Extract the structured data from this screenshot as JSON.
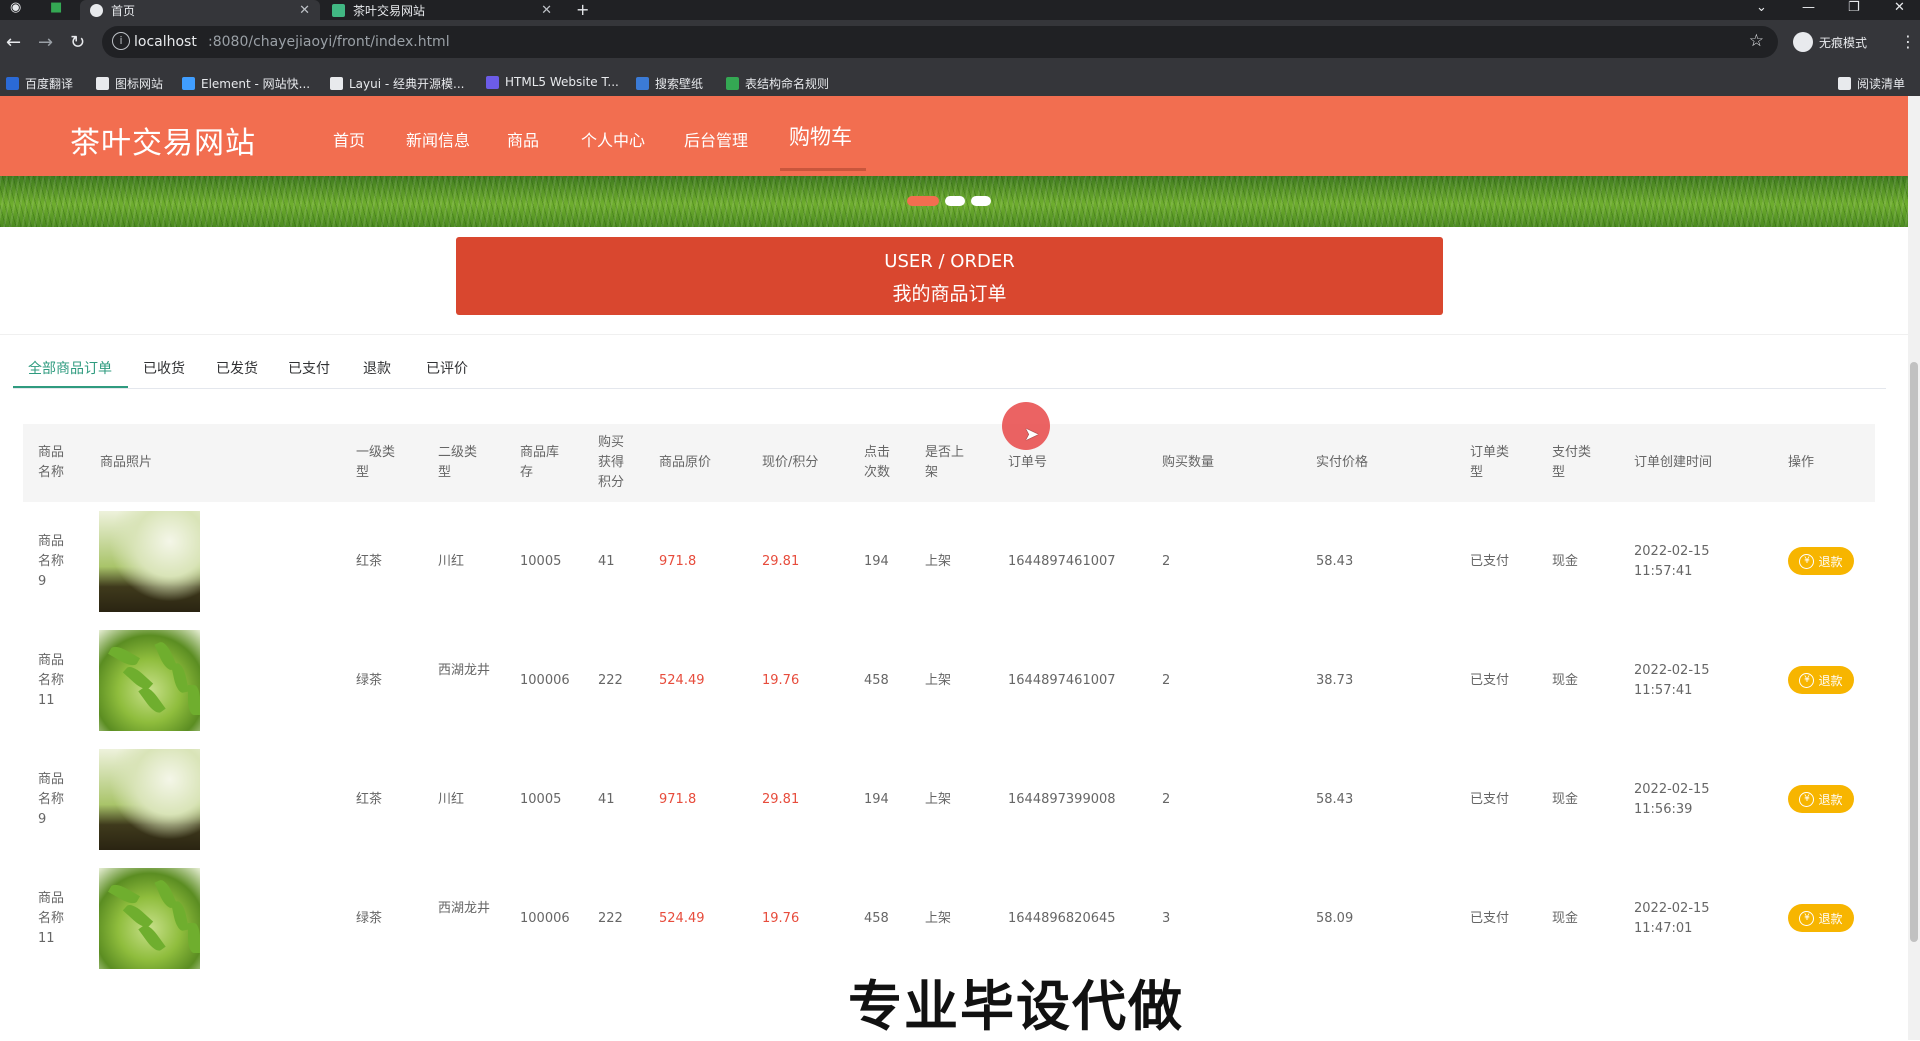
{
  "browser": {
    "tabs": [
      {
        "title": "首页",
        "active": true
      },
      {
        "title": "茶叶交易网站",
        "active": false
      }
    ],
    "new_tab": "+",
    "url_host": "localhost",
    "url_path": ":8080/chayejiaoyi/front/index.html",
    "incognito_label": "无痕模式",
    "bookmarks": [
      "百度翻译",
      "图标网站",
      "Element - 网站快...",
      "Layui - 经典开源模...",
      "HTML5 Website T...",
      "搜索壁纸",
      "表结构命名规则"
    ],
    "reading_list": "阅读清单"
  },
  "site": {
    "title": "茶叶交易网站",
    "nav": [
      "首页",
      "新闻信息",
      "商品",
      "个人中心",
      "后台管理",
      "购物车"
    ],
    "active_nav": "购物车",
    "accent_color": "#f26e50"
  },
  "hero": {
    "line1": "USER / ORDER",
    "line2": "我的商品订单"
  },
  "order_tabs": [
    "全部商品订单",
    "已收货",
    "已发货",
    "已支付",
    "退款",
    "已评价"
  ],
  "table": {
    "headers": [
      "商品名称",
      "商品照片",
      "一级类型",
      "二级类型",
      "商品库存",
      "购买获得积分",
      "商品原价",
      "现价/积分",
      "点击次数",
      "是否上架",
      "订单号",
      "购买数量",
      "实付价格",
      "订单类型",
      "支付类型",
      "订单创建时间",
      "操作"
    ],
    "rows": [
      {
        "name": "商品名称9",
        "photo": "tea-sprout-photo",
        "type1": "红茶",
        "type2": "川红",
        "stock": "10005",
        "points": "41",
        "orig_price": "971.8",
        "cur_price": "29.81",
        "clicks": "194",
        "on_shelf": "上架",
        "order_no": "1644897461007",
        "qty": "2",
        "paid": "58.43",
        "order_type": "已支付",
        "pay_type": "现金",
        "created_date": "2022-02-15",
        "created_time": "11:57:41",
        "action": "退款"
      },
      {
        "name": "商品名称11",
        "photo": "green-tea-leaves-photo",
        "type1": "绿茶",
        "type2": "西湖龙井",
        "stock": "100006",
        "points": "222",
        "orig_price": "524.49",
        "cur_price": "19.76",
        "clicks": "458",
        "on_shelf": "上架",
        "order_no": "1644897461007",
        "qty": "2",
        "paid": "38.73",
        "order_type": "已支付",
        "pay_type": "现金",
        "created_date": "2022-02-15",
        "created_time": "11:57:41",
        "action": "退款"
      },
      {
        "name": "商品名称9",
        "photo": "tea-sprout-photo",
        "type1": "红茶",
        "type2": "川红",
        "stock": "10005",
        "points": "41",
        "orig_price": "971.8",
        "cur_price": "29.81",
        "clicks": "194",
        "on_shelf": "上架",
        "order_no": "1644897399008",
        "qty": "2",
        "paid": "58.43",
        "order_type": "已支付",
        "pay_type": "现金",
        "created_date": "2022-02-15",
        "created_time": "11:56:39",
        "action": "退款"
      },
      {
        "name": "商品名称11",
        "photo": "green-tea-leaves-photo",
        "type1": "绿茶",
        "type2": "西湖龙井",
        "stock": "100006",
        "points": "222",
        "orig_price": "524.49",
        "cur_price": "19.76",
        "clicks": "458",
        "on_shelf": "上架",
        "order_no": "1644896820645",
        "qty": "3",
        "paid": "58.09",
        "order_type": "已支付",
        "pay_type": "现金",
        "created_date": "2022-02-15",
        "created_time": "11:47:01",
        "action": "退款"
      }
    ]
  },
  "overlay": {
    "watermark": "专业毕设代做"
  },
  "colors": {
    "price_red": "#e74c3c",
    "refund_yellow": "#f7b500",
    "tab_active": "#2f9b7f",
    "hero_bg": "#d9472f"
  }
}
